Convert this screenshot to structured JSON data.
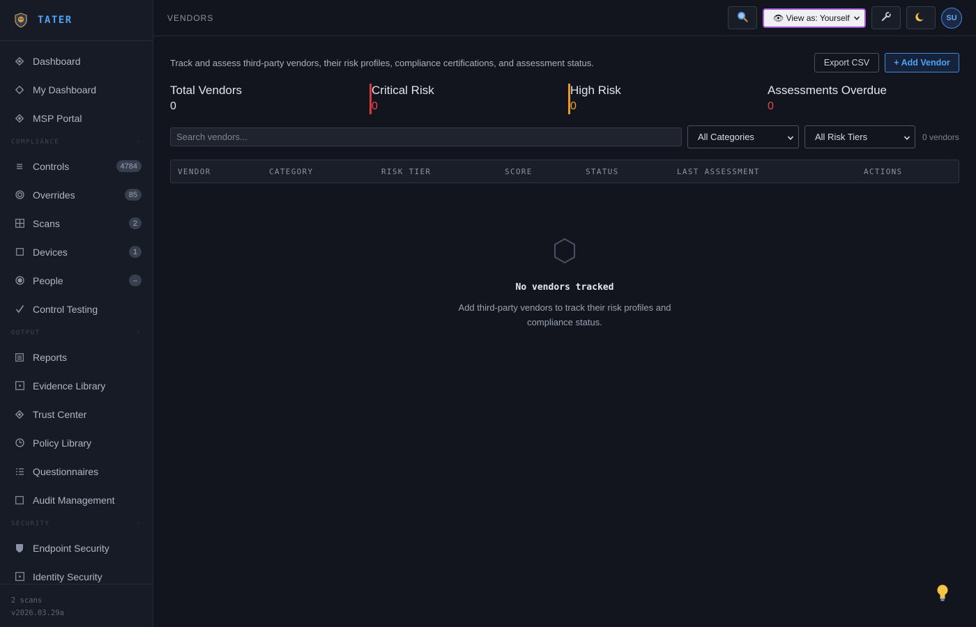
{
  "app": {
    "name": "TATER"
  },
  "nav": {
    "top": [
      {
        "label": "Dashboard",
        "icon": "diamond-icon"
      },
      {
        "label": "My Dashboard",
        "icon": "diamond-outline-icon"
      },
      {
        "label": "MSP Portal",
        "icon": "diamond-icon"
      }
    ],
    "compliance_label": "COMPLIANCE",
    "compliance": [
      {
        "label": "Controls",
        "icon": "list-icon",
        "badge": "4784"
      },
      {
        "label": "Overrides",
        "icon": "target-icon",
        "badge": "85"
      },
      {
        "label": "Scans",
        "icon": "grid-icon",
        "badge": "2"
      },
      {
        "label": "Devices",
        "icon": "square-icon",
        "badge": "1"
      },
      {
        "label": "People",
        "icon": "person-icon",
        "badge": "–"
      },
      {
        "label": "Control Testing",
        "icon": "check-icon",
        "badge": ""
      }
    ],
    "output_label": "OUTPUT",
    "output": [
      {
        "label": "Reports",
        "icon": "report-icon"
      },
      {
        "label": "Evidence Library",
        "icon": "evidence-icon"
      },
      {
        "label": "Trust Center",
        "icon": "diamond-icon"
      },
      {
        "label": "Policy Library",
        "icon": "clock-icon"
      },
      {
        "label": "Questionnaires",
        "icon": "checklist-icon"
      },
      {
        "label": "Audit Management",
        "icon": "square-icon"
      }
    ],
    "security_label": "SECURITY",
    "security": [
      {
        "label": "Endpoint Security",
        "icon": "shield-icon"
      },
      {
        "label": "Identity Security",
        "icon": "id-icon"
      }
    ]
  },
  "footer": {
    "scans": "2 scans",
    "version": "v2026.03.29a"
  },
  "topbar": {
    "breadcrumb": "VENDORS",
    "search_icon": "magnifier-icon",
    "view_as": "👁 View as: Yourself",
    "tools_icon": "wrench-icon",
    "theme_icon": "moon-icon",
    "avatar": "SU"
  },
  "page": {
    "description": "Track and assess third-party vendors, their risk profiles, compliance certifications, and assessment status.",
    "export_label": "Export CSV",
    "add_label": "+ Add Vendor"
  },
  "stats": [
    {
      "label": "Total Vendors",
      "value": "0",
      "color": "#e1e4ea",
      "bar": ""
    },
    {
      "label": "Critical Risk",
      "value": "0",
      "color": "#e5484d",
      "bar": "#d63c3c"
    },
    {
      "label": "High Risk",
      "value": "0",
      "color": "#f5a524",
      "bar": "#e89b1c"
    },
    {
      "label": "Assessments Overdue",
      "value": "0",
      "color": "#e5484d",
      "bar": ""
    }
  ],
  "filters": {
    "search_placeholder": "Search vendors...",
    "category": "All Categories",
    "risk_tier": "All Risk Tiers",
    "count": "0 vendors"
  },
  "table": {
    "columns": [
      "VENDOR",
      "CATEGORY",
      "RISK TIER",
      "SCORE",
      "STATUS",
      "LAST ASSESSMENT",
      "ACTIONS"
    ]
  },
  "empty": {
    "title": "No vendors tracked",
    "description": "Add third-party vendors to track their risk profiles and compliance status."
  },
  "colors": {
    "accent": "#4ea3f5",
    "view_as_border": "#a55ad6",
    "bg": "#12151e",
    "sidebar": "#171b25"
  }
}
